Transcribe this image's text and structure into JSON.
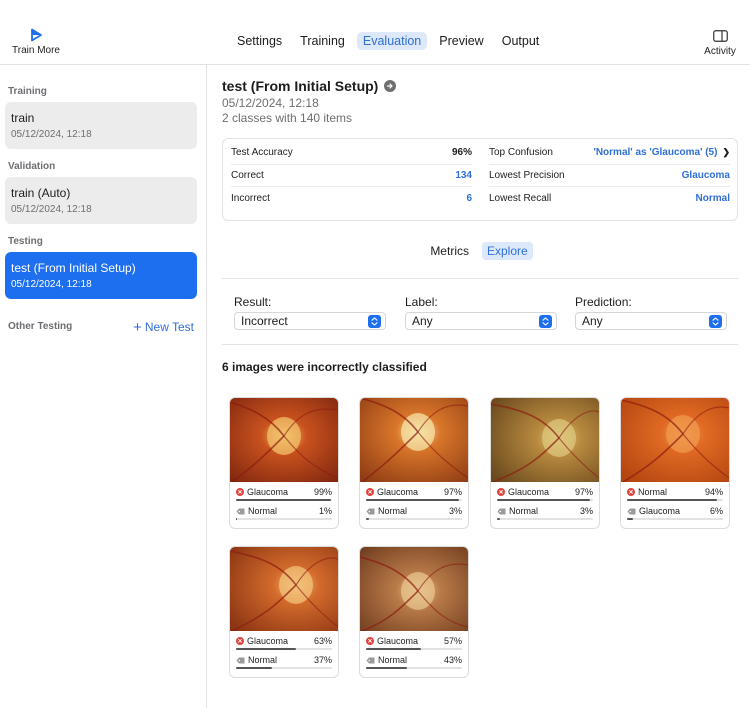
{
  "toolbar": {
    "train_more": "Train More",
    "tabs": [
      {
        "label": "Settings",
        "active": false
      },
      {
        "label": "Training",
        "active": false
      },
      {
        "label": "Evaluation",
        "active": true
      },
      {
        "label": "Preview",
        "active": false
      },
      {
        "label": "Output",
        "active": false
      }
    ],
    "activity": "Activity",
    "accent": "#2f6fd6"
  },
  "sidebar": {
    "training_head": "Training",
    "training_item": {
      "title": "train",
      "date": "05/12/2024, 12:18"
    },
    "validation_head": "Validation",
    "validation_item": {
      "title": "train (Auto)",
      "date": "05/12/2024, 12:18"
    },
    "testing_head": "Testing",
    "testing_item": {
      "title": "test (From Initial Setup)",
      "date": "05/12/2024, 12:18"
    },
    "other_testing": "Other Testing",
    "new_test": "New Test"
  },
  "main": {
    "title": "test (From Initial Setup)",
    "date": "05/12/2024, 12:18",
    "summary": "2 classes with 140 items",
    "stats_left": [
      {
        "label": "Test Accuracy",
        "value": "96%",
        "blue": false
      },
      {
        "label": "Correct",
        "value": "134",
        "blue": true
      },
      {
        "label": "Incorrect",
        "value": "6",
        "blue": true
      }
    ],
    "stats_right": [
      {
        "label": "Top Confusion",
        "value": "'Normal' as 'Glaucoma' (5)",
        "blue": true
      },
      {
        "label": "Lowest Precision",
        "value": "Glaucoma",
        "blue": true
      },
      {
        "label": "Lowest Recall",
        "value": "Normal",
        "blue": true
      }
    ],
    "segments": [
      {
        "label": "Metrics",
        "active": false
      },
      {
        "label": "Explore",
        "active": true
      }
    ],
    "filters": [
      {
        "label": "Result:",
        "value": "Incorrect"
      },
      {
        "label": "Label:",
        "value": "Any"
      },
      {
        "label": "Prediction:",
        "value": "Any"
      }
    ],
    "result_heading": "6 images were incorrectly classified",
    "images": [
      {
        "pred": "Glaucoma",
        "pred_pct": "99%",
        "pred_frac": 0.99,
        "label": "Normal",
        "label_pct": "1%",
        "label_frac": 0.01
      },
      {
        "pred": "Glaucoma",
        "pred_pct": "97%",
        "pred_frac": 0.97,
        "label": "Normal",
        "label_pct": "3%",
        "label_frac": 0.03
      },
      {
        "pred": "Glaucoma",
        "pred_pct": "97%",
        "pred_frac": 0.97,
        "label": "Normal",
        "label_pct": "3%",
        "label_frac": 0.03
      },
      {
        "pred": "Normal",
        "pred_pct": "94%",
        "pred_frac": 0.94,
        "label": "Glaucoma",
        "label_pct": "6%",
        "label_frac": 0.06
      },
      {
        "pred": "Glaucoma",
        "pred_pct": "63%",
        "pred_frac": 0.63,
        "label": "Normal",
        "label_pct": "37%",
        "label_frac": 0.37
      },
      {
        "pred": "Glaucoma",
        "pred_pct": "57%",
        "pred_frac": 0.57,
        "label": "Normal",
        "label_pct": "43%",
        "label_frac": 0.43
      }
    ]
  }
}
